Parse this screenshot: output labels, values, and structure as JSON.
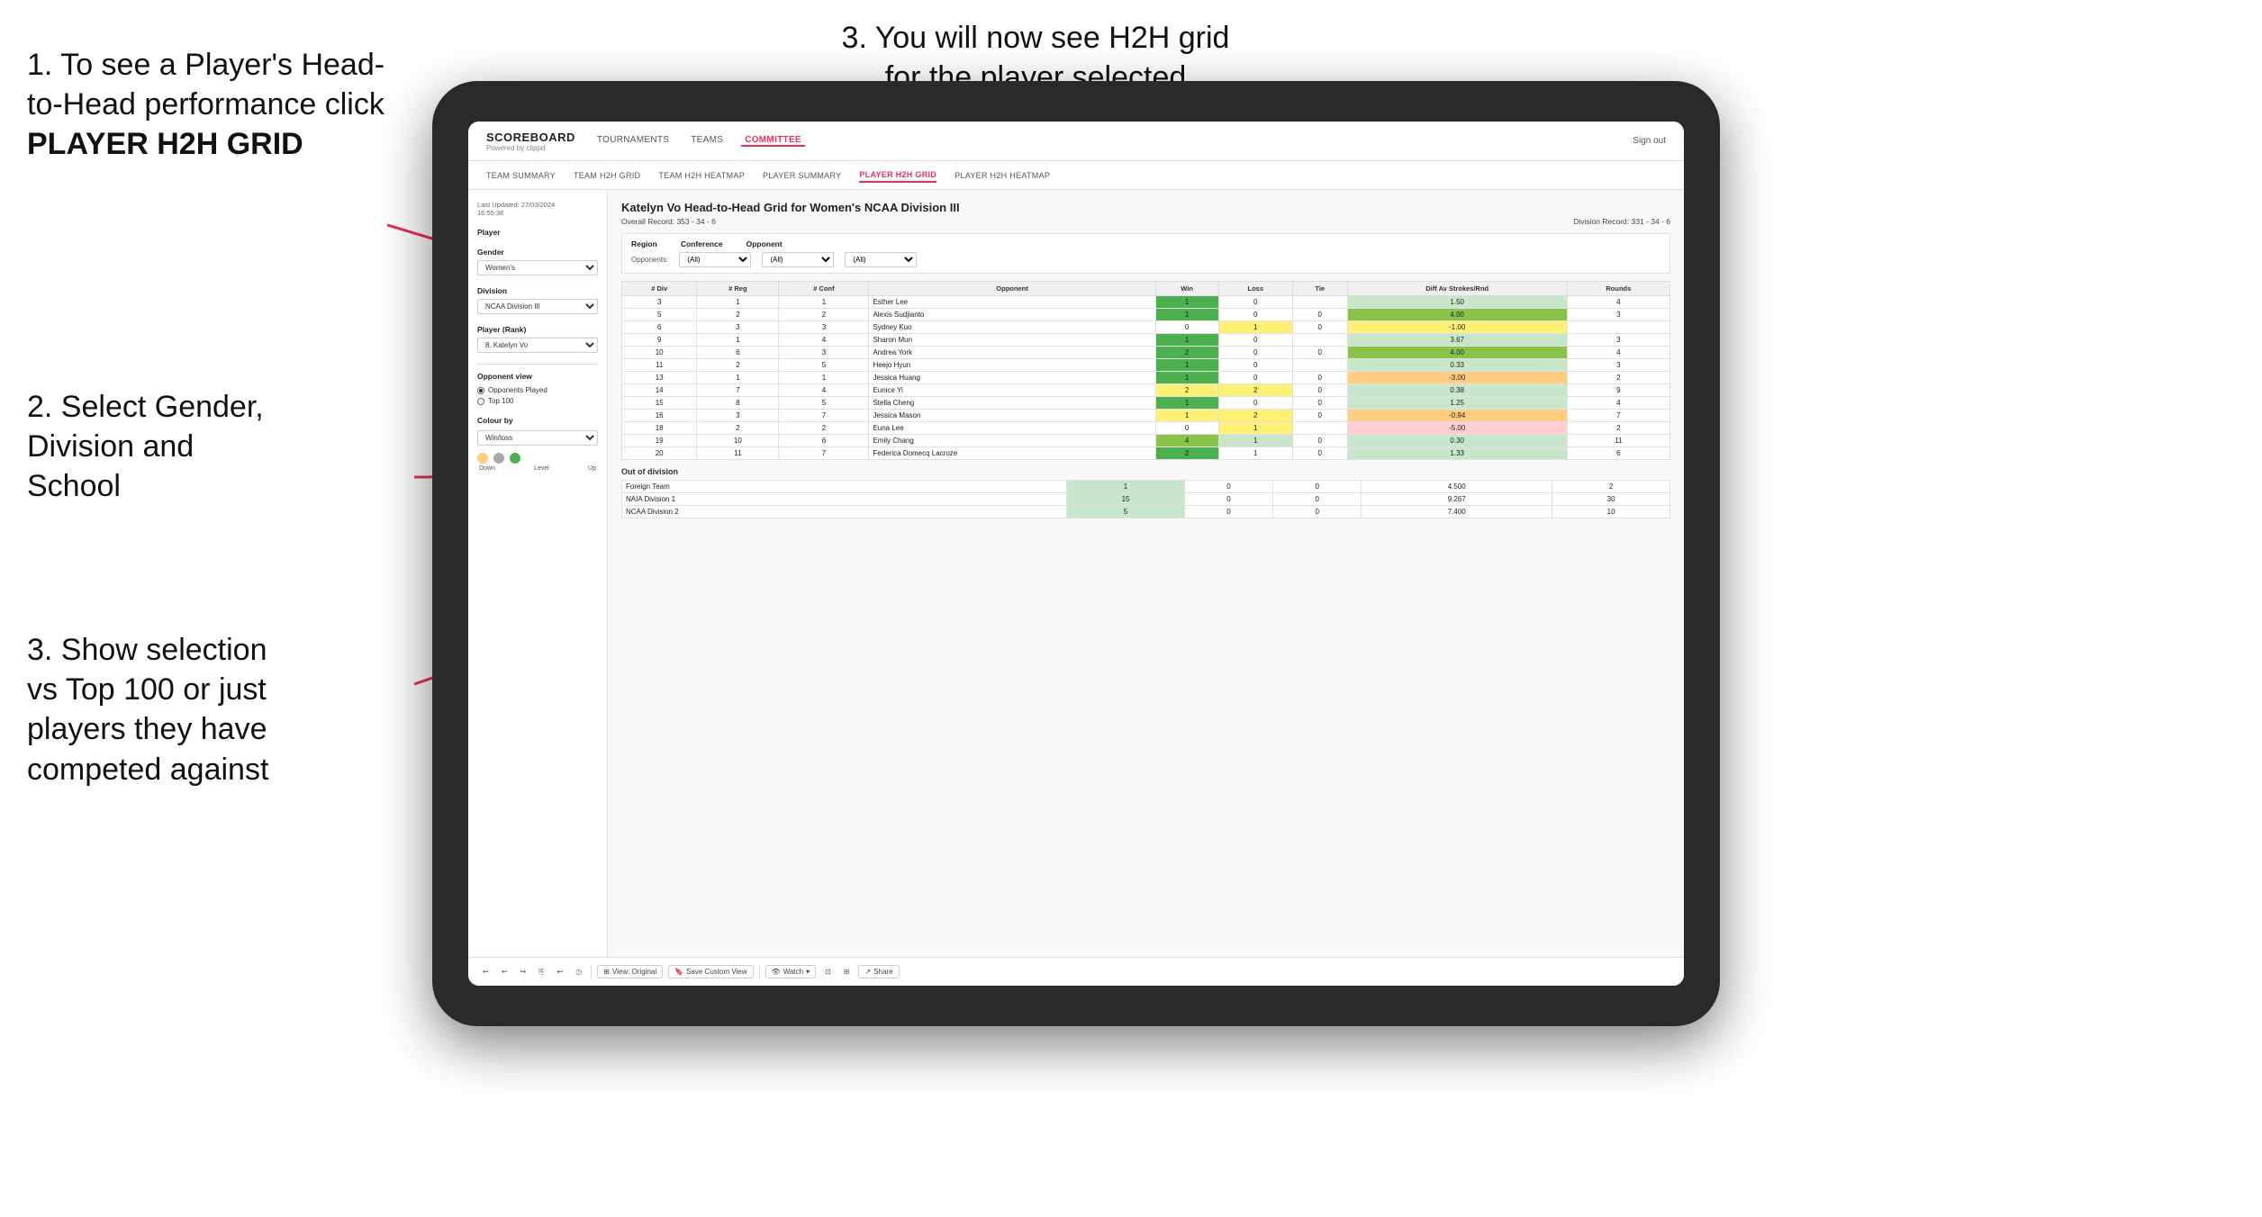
{
  "instructions": {
    "step1_line1": "1. To see a Player's Head-",
    "step1_line2": "to-Head performance click",
    "step1_bold": "PLAYER H2H GRID",
    "step2_line1": "2. Select Gender,",
    "step2_line2": "Division and",
    "step2_line3": "School",
    "step3_bottom_line1": "3. Show selection",
    "step3_bottom_line2": "vs Top 100 or just",
    "step3_bottom_line3": "players they have",
    "step3_bottom_line4": "competed against",
    "step3_top_line1": "3. You will now see H2H grid",
    "step3_top_line2": "for the player selected"
  },
  "navbar": {
    "logo": "SCOREBOARD",
    "powered_by": "Powered by clippd",
    "nav_items": [
      "TOURNAMENTS",
      "TEAMS",
      "COMMITTEE"
    ],
    "sign_out": "Sign out"
  },
  "sub_navbar": {
    "items": [
      "TEAM SUMMARY",
      "TEAM H2H GRID",
      "TEAM H2H HEATMAP",
      "PLAYER SUMMARY",
      "PLAYER H2H GRID",
      "PLAYER H2H HEATMAP"
    ]
  },
  "sidebar": {
    "timestamp": "Last Updated: 27/03/2024",
    "time": "16:55:38",
    "player_label": "Player",
    "gender_label": "Gender",
    "gender_value": "Women's",
    "division_label": "Division",
    "division_value": "NCAA Division III",
    "player_rank_label": "Player (Rank)",
    "player_rank_value": "8. Katelyn Vo",
    "opponent_view_label": "Opponent view",
    "radio_1": "Opponents Played",
    "radio_2": "Top 100",
    "colour_by_label": "Colour by",
    "colour_win_loss": "Win/loss",
    "colour_labels": [
      "Down",
      "Level",
      "Up"
    ]
  },
  "content": {
    "title": "Katelyn Vo Head-to-Head Grid for Women's NCAA Division III",
    "overall_record_label": "Overall Record:",
    "overall_record_value": "353 - 34 - 6",
    "division_record_label": "Division Record:",
    "division_record_value": "331 - 34 - 6",
    "region_label": "Region",
    "conference_label": "Conference",
    "opponent_label": "Opponent",
    "opponents_label": "Opponents:",
    "all_option": "(All)",
    "columns": [
      "# Div",
      "# Reg",
      "# Conf",
      "Opponent",
      "Win",
      "Loss",
      "Tie",
      "Diff Av Strokes/Rnd",
      "Rounds"
    ],
    "rows": [
      {
        "div": "3",
        "reg": "1",
        "conf": "1",
        "opponent": "Esther Lee",
        "win": "1",
        "loss": "0",
        "tie": "",
        "diff": "1.50",
        "rounds": "4",
        "win_color": "green_dark",
        "loss_color": "white",
        "tie_color": "white",
        "diff_color": "green_light"
      },
      {
        "div": "5",
        "reg": "2",
        "conf": "2",
        "opponent": "Alexis Sudjianto",
        "win": "1",
        "loss": "0",
        "tie": "0",
        "diff": "4.00",
        "rounds": "3",
        "win_color": "green_dark",
        "loss_color": "white",
        "tie_color": "white",
        "diff_color": "green_med"
      },
      {
        "div": "6",
        "reg": "3",
        "conf": "3",
        "opponent": "Sydney Kuo",
        "win": "0",
        "loss": "1",
        "tie": "0",
        "diff": "-1.00",
        "rounds": "",
        "win_color": "white",
        "loss_color": "yellow",
        "tie_color": "white",
        "diff_color": "yellow"
      },
      {
        "div": "9",
        "reg": "1",
        "conf": "4",
        "opponent": "Sharon Mun",
        "win": "1",
        "loss": "0",
        "tie": "",
        "diff": "3.67",
        "rounds": "3",
        "win_color": "green_dark",
        "loss_color": "white",
        "tie_color": "white",
        "diff_color": "green_light"
      },
      {
        "div": "10",
        "reg": "6",
        "conf": "3",
        "opponent": "Andrea York",
        "win": "2",
        "loss": "0",
        "tie": "0",
        "diff": "4.00",
        "rounds": "4",
        "win_color": "green_dark",
        "loss_color": "white",
        "tie_color": "white",
        "diff_color": "green_med"
      },
      {
        "div": "11",
        "reg": "2",
        "conf": "5",
        "opponent": "Heejo Hyun",
        "win": "1",
        "loss": "0",
        "tie": "",
        "diff": "0.33",
        "rounds": "3",
        "win_color": "green_dark",
        "loss_color": "white",
        "tie_color": "white",
        "diff_color": "green_light"
      },
      {
        "div": "13",
        "reg": "1",
        "conf": "1",
        "opponent": "Jessica Huang",
        "win": "1",
        "loss": "0",
        "tie": "0",
        "diff": "-3.00",
        "rounds": "2",
        "win_color": "green_dark",
        "loss_color": "white",
        "tie_color": "white",
        "diff_color": "orange"
      },
      {
        "div": "14",
        "reg": "7",
        "conf": "4",
        "opponent": "Eunice Yi",
        "win": "2",
        "loss": "2",
        "tie": "0",
        "diff": "0.38",
        "rounds": "9",
        "win_color": "yellow",
        "loss_color": "yellow",
        "tie_color": "white",
        "diff_color": "green_light"
      },
      {
        "div": "15",
        "reg": "8",
        "conf": "5",
        "opponent": "Stella Cheng",
        "win": "1",
        "loss": "0",
        "tie": "0",
        "diff": "1.25",
        "rounds": "4",
        "win_color": "green_dark",
        "loss_color": "white",
        "tie_color": "white",
        "diff_color": "green_light"
      },
      {
        "div": "16",
        "reg": "3",
        "conf": "7",
        "opponent": "Jessica Mason",
        "win": "1",
        "loss": "2",
        "tie": "0",
        "diff": "-0.94",
        "rounds": "7",
        "win_color": "yellow",
        "loss_color": "yellow",
        "tie_color": "white",
        "diff_color": "orange"
      },
      {
        "div": "18",
        "reg": "2",
        "conf": "2",
        "opponent": "Euna Lee",
        "win": "0",
        "loss": "1",
        "tie": "",
        "diff": "-5.00",
        "rounds": "2",
        "win_color": "white",
        "loss_color": "yellow",
        "tie_color": "white",
        "diff_color": "red_light"
      },
      {
        "div": "19",
        "reg": "10",
        "conf": "6",
        "opponent": "Emily Chang",
        "win": "4",
        "loss": "1",
        "tie": "0",
        "diff": "0.30",
        "rounds": "11",
        "win_color": "green_med",
        "loss_color": "green_light",
        "tie_color": "white",
        "diff_color": "green_light"
      },
      {
        "div": "20",
        "reg": "11",
        "conf": "7",
        "opponent": "Federica Domecq Lacroze",
        "win": "2",
        "loss": "1",
        "tie": "0",
        "diff": "1.33",
        "rounds": "6",
        "win_color": "green_dark",
        "loss_color": "white",
        "tie_color": "white",
        "diff_color": "green_light"
      }
    ],
    "out_of_division_label": "Out of division",
    "out_of_division_rows": [
      {
        "team": "Foreign Team",
        "win": "1",
        "loss": "0",
        "tie": "0",
        "diff": "4.500",
        "rounds": "2"
      },
      {
        "team": "NAIA Division 1",
        "win": "15",
        "loss": "0",
        "tie": "0",
        "diff": "9.267",
        "rounds": "30"
      },
      {
        "team": "NCAA Division 2",
        "win": "5",
        "loss": "0",
        "tie": "0",
        "diff": "7.400",
        "rounds": "10"
      }
    ]
  },
  "toolbar": {
    "buttons": [
      "↩",
      "↩",
      "↪",
      "⎘",
      "↩",
      "◷"
    ],
    "view_original": "View: Original",
    "save_custom": "Save Custom View",
    "watch": "Watch",
    "share": "Share"
  },
  "colors": {
    "accent": "#e8315a",
    "green_dark": "#4caf50",
    "green_med": "#8bc34a",
    "green_light": "#c8e6c9",
    "yellow": "#fff176",
    "orange": "#ffcc80",
    "red_light": "#ffcdd2"
  }
}
